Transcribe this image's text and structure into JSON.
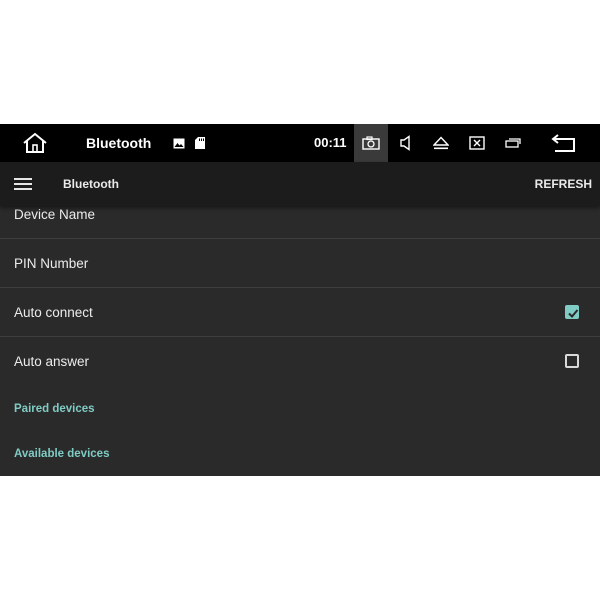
{
  "statusbar": {
    "home_icon": "home-icon",
    "title": "Bluetooth",
    "image_icon": "image-icon",
    "sdcard_icon": "sd-card-icon",
    "time": "00:11",
    "icons": [
      "screenshot-icon",
      "volume-icon",
      "eject-icon",
      "close-window-icon",
      "minimize-icon",
      "back-icon"
    ]
  },
  "appbar": {
    "title": "Bluetooth",
    "refresh_label": "REFRESH"
  },
  "settings": {
    "rows": [
      {
        "label": "Device Name"
      },
      {
        "label": "PIN Number"
      },
      {
        "label": "Auto connect",
        "checked": true
      },
      {
        "label": "Auto answer",
        "checked": false
      }
    ],
    "sections": {
      "paired": "Paired devices",
      "available": "Available devices"
    }
  },
  "colors": {
    "accent": "#80cbc4",
    "background": "#2a2a2a",
    "statusbar": "#000000",
    "appbar": "#1c1c1c"
  }
}
